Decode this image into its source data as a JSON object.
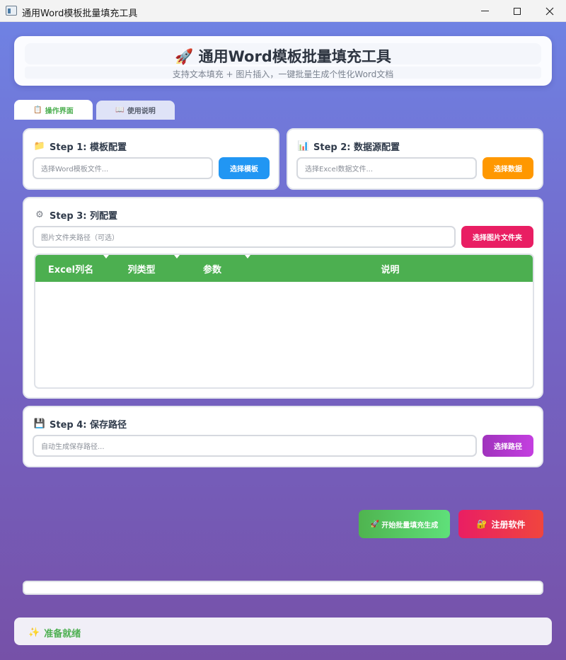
{
  "window": {
    "title": "通用Word模板批量填充工具",
    "icon": "app-window-icon",
    "controls": [
      "minimize",
      "maximize",
      "close"
    ]
  },
  "header": {
    "icon": "rocket-icon",
    "icon_glyph": "🚀",
    "title": "通用Word模板批量填充工具",
    "subtitle": "支持文本填充 + 图片插入，一键批量生成个性化Word文档"
  },
  "tabs": [
    {
      "icon_glyph": "📋",
      "label": "操作界面",
      "active": true
    },
    {
      "icon_glyph": "📖",
      "label": "使用说明",
      "active": false
    }
  ],
  "step1": {
    "icon_glyph": "📁",
    "title": "Step 1: 模板配置",
    "input_placeholder": "选择Word模板文件...",
    "button_label": "选择模板",
    "button_color": "#2196f3"
  },
  "step2": {
    "icon_glyph": "📊",
    "title": "Step 2: 数据源配置",
    "input_placeholder": "选择Excel数据文件...",
    "button_label": "选择数据",
    "button_color": "#ff9800"
  },
  "step3": {
    "icon_glyph": "⚙",
    "title": "Step 3: 列配置",
    "input_placeholder": "图片文件夹路径（可选）",
    "button_label": "选择图片文件夹",
    "button_color": "#e91e63",
    "table": {
      "header_color": "#4caf50",
      "columns": [
        "Excel列名",
        "列类型",
        "参数",
        "说明"
      ],
      "rows": []
    }
  },
  "step4": {
    "icon_glyph": "💾",
    "title": "Step 4: 保存路径",
    "input_placeholder": "自动生成保存路径...",
    "button_label": "选择路径",
    "button_color": "#9c27b0"
  },
  "actions": {
    "start_glyph": "🚀",
    "start_label": "开始批量填充生成",
    "register_glyph": "🔐",
    "register_label": "注册软件"
  },
  "progress": {
    "value": 0
  },
  "status": {
    "icon_glyph": "✨",
    "text": "准备就绪",
    "color": "#4caf50"
  }
}
